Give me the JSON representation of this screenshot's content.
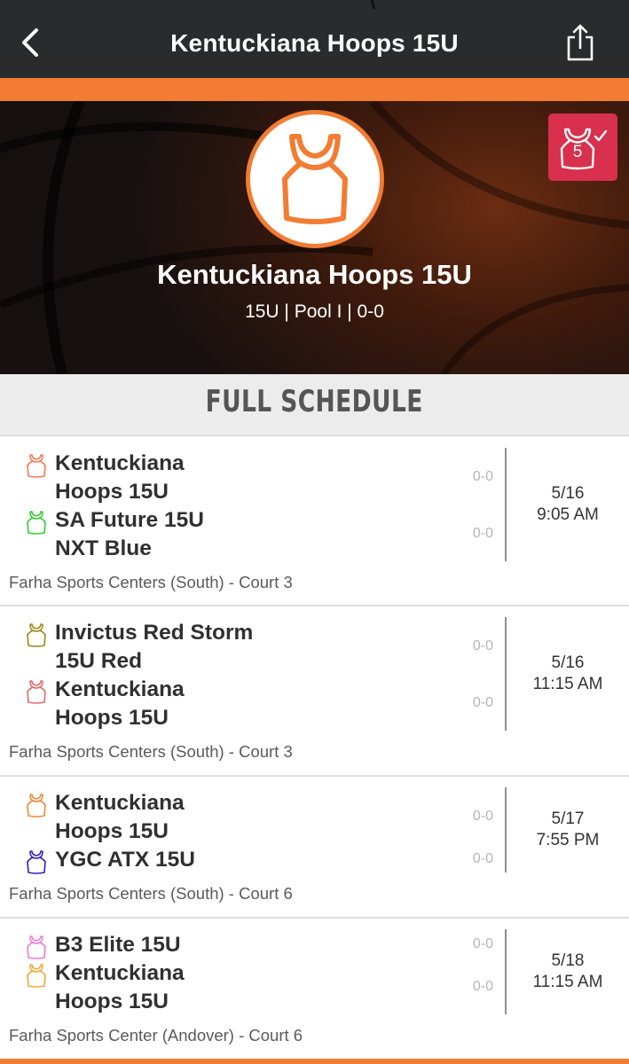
{
  "nav": {
    "title": "Kentuckiana Hoops 15U",
    "back_icon": "chevron-left-icon",
    "share_icon": "share-icon"
  },
  "colors": {
    "accent": "#f27c32",
    "nav_bg": "#2a2b2c",
    "badge": "#d8304d"
  },
  "hero": {
    "team_name": "Kentuckiana Hoops 15U",
    "subtitle": "15U | Pool I | 0-0",
    "logo_icon": "jersey-icon",
    "badge_icon": "jersey-check-icon",
    "badge_number": "5"
  },
  "section": {
    "title": "FULL SCHEDULE"
  },
  "games": [
    {
      "team1": {
        "name_line1": "Kentuckiana",
        "name_line2": "Hoops 15U",
        "score": "0-0",
        "jersey_color": "#f47a52"
      },
      "team2": {
        "name_line1": "SA Future 15U",
        "name_line2": "NXT Blue",
        "score": "0-0",
        "jersey_color": "#33cc33"
      },
      "date": "5/16",
      "time": "9:05 AM",
      "venue": "Farha Sports Centers (South) - Court 3"
    },
    {
      "team1": {
        "name_line1": "Invictus Red Storm",
        "name_line2": "15U Red",
        "score": "0-0",
        "jersey_color": "#9a8a18"
      },
      "team2": {
        "name_line1": "Kentuckiana",
        "name_line2": "Hoops 15U",
        "score": "0-0",
        "jersey_color": "#e06b6b"
      },
      "date": "5/16",
      "time": "11:15 AM",
      "venue": "Farha Sports Centers (South) - Court 3"
    },
    {
      "team1": {
        "name_line1": "Kentuckiana",
        "name_line2": "Hoops 15U",
        "score": "0-0",
        "jersey_color": "#f0883a"
      },
      "team2": {
        "name_line1": "YGC ATX 15U",
        "name_line2": "",
        "score": "0-0",
        "jersey_color": "#2a24b8"
      },
      "date": "5/17",
      "time": "7:55 PM",
      "venue": "Farha Sports Centers (South) - Court 6"
    },
    {
      "team1": {
        "name_line1": "B3 Elite 15U",
        "name_line2": "",
        "score": "0-0",
        "jersey_color": "#f07ad8"
      },
      "team2": {
        "name_line1": "Kentuckiana",
        "name_line2": "Hoops 15U",
        "score": "0-0",
        "jersey_color": "#f0a83a"
      },
      "date": "5/18",
      "time": "11:15 AM",
      "venue": "Farha Sports Center (Andover) - Court 6"
    }
  ]
}
